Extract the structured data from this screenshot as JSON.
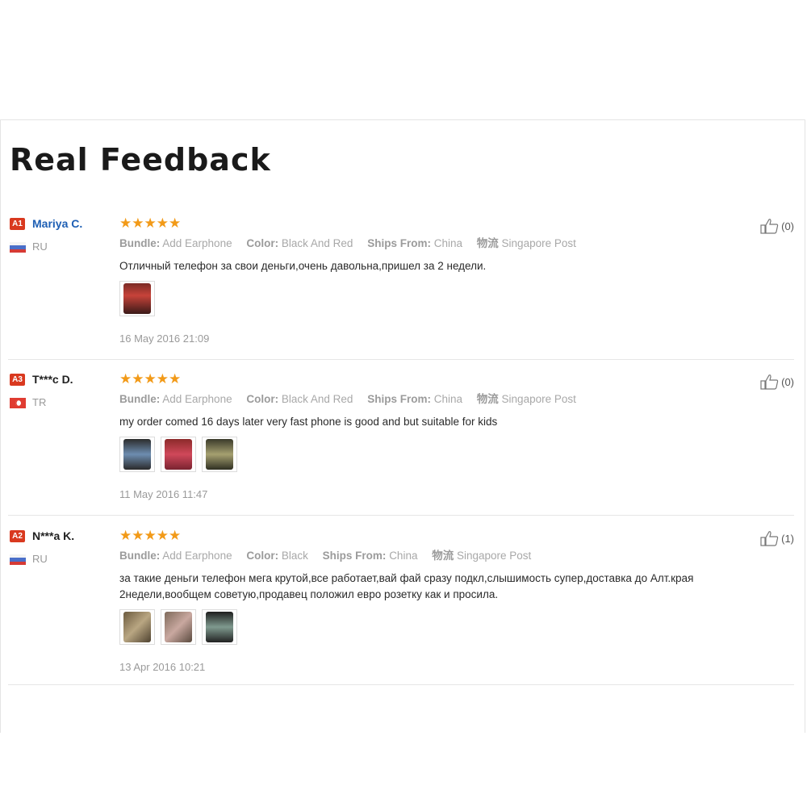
{
  "page": {
    "title": "Real Feedback"
  },
  "labels": {
    "bundle": "Bundle:",
    "color": "Color:",
    "ships_from": "Ships From:",
    "shipping": "物流"
  },
  "colors": {
    "accent": "#f29a18",
    "badge": "#d9391f",
    "link": "#1e5fb4"
  },
  "reviews": [
    {
      "level": "A1",
      "buyer": "Mariya C.",
      "country": "RU",
      "flag": "russia-flag",
      "stars": "★★★★★",
      "rating": 5,
      "bundle": "Add Earphone",
      "color": "Black And Red",
      "ships_from": "China",
      "shipping_method": "Singapore Post",
      "text": [
        "Отличный телефон за свои деньги,очень давольна,пришел за 2 недели."
      ],
      "photos": 1,
      "date": "16 May 2016 21:09",
      "helpful": "(0)"
    },
    {
      "level": "A3",
      "buyer": "T***c D.",
      "country": "TR",
      "flag": "turkey-flag",
      "stars": "★★★★★",
      "rating": 5,
      "bundle": "Add Earphone",
      "color": "Black And Red",
      "ships_from": "China",
      "shipping_method": "Singapore Post",
      "text": [
        "my order comed 16 days later very fast phone is good and but suitable for kids"
      ],
      "photos": 3,
      "date": "11 May 2016 11:47",
      "helpful": "(0)"
    },
    {
      "level": "A2",
      "buyer": "N***a K.",
      "country": "RU",
      "flag": "russia-flag",
      "stars": "★★★★★",
      "rating": 5,
      "bundle": "Add Earphone",
      "color": "Black",
      "ships_from": "China",
      "shipping_method": "Singapore Post",
      "text": [
        "за такие деньги телефон мега крутой,все работает,вай фай сразу подкл,слышимость супер,доставка до Алт.края",
        "2недели,вообщем советую,продавец положил евро розетку как и просила."
      ],
      "photos": 3,
      "date": "13 Apr 2016 10:21",
      "helpful": "(1)"
    }
  ]
}
